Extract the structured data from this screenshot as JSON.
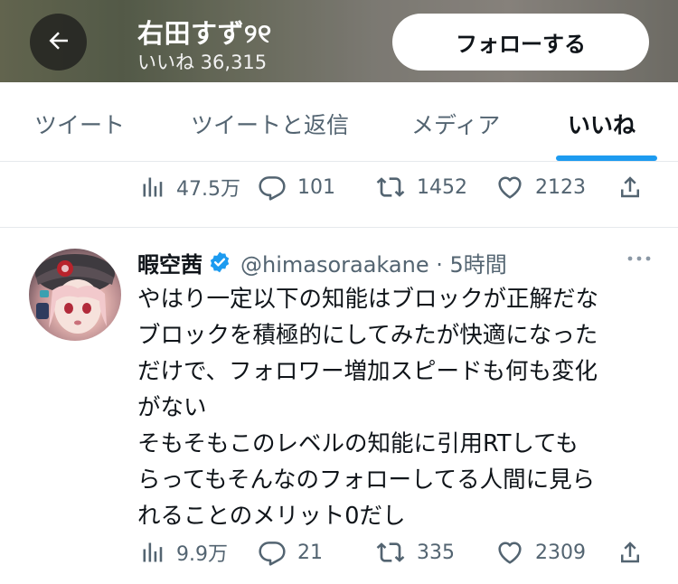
{
  "header": {
    "title": "右田すず୨୧",
    "subtitle": "いいね 36,315",
    "follow_label": "フォローする"
  },
  "tabs": [
    {
      "label": "ツイート",
      "active": false
    },
    {
      "label": "ツイートと返信",
      "active": false
    },
    {
      "label": "メディア",
      "active": false
    },
    {
      "label": "いいね",
      "active": true
    }
  ],
  "accent_color": "#1d9bf0",
  "previous_tweet": {
    "views": "47.5万",
    "replies": "101",
    "retweets": "1452",
    "likes": "2123"
  },
  "tweet": {
    "display_name": "暇空茜",
    "verified": true,
    "handle_time": "@himasoraakane · 5時間",
    "body_lines": [
      "やはり一定以下の知能はブロックが正解だな",
      "ブロックを積極的にしてみたが快適になった",
      "だけで、フォロワー増加スピードも何も変化",
      "がない",
      "そもそもこのレベルの知能に引用RTしても",
      "らってもそんなのフォローしてる人間に見ら",
      "れることのメリット0だし"
    ],
    "views": "9.9万",
    "replies": "21",
    "retweets": "335",
    "likes": "2309"
  }
}
